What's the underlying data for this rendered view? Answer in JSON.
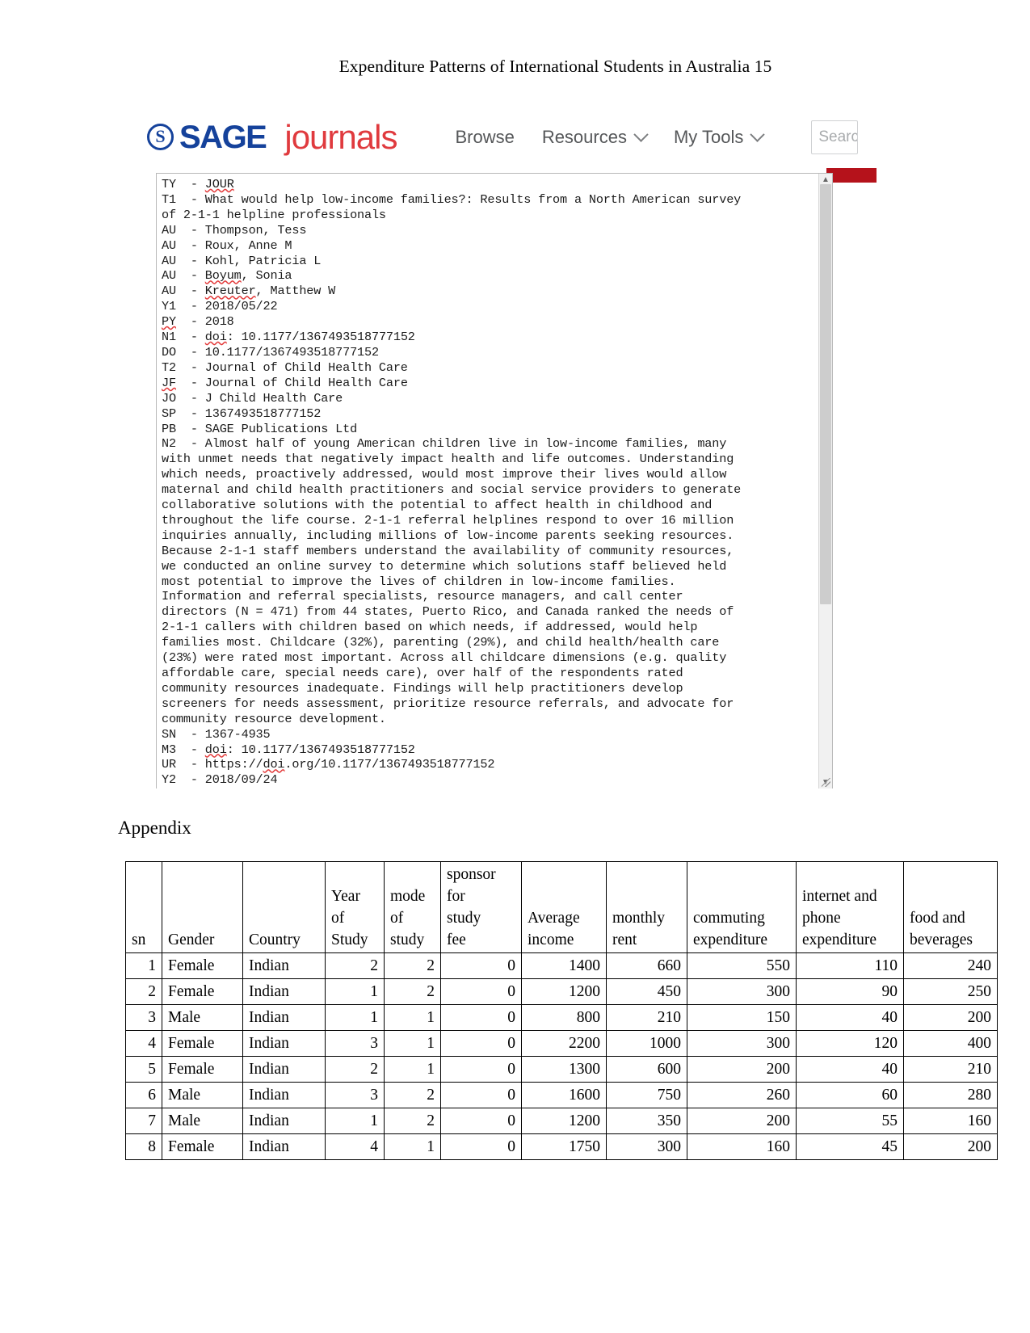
{
  "running_head": "Expenditure Patterns of International Students in Australia 15",
  "sage": {
    "logo_mark": "S",
    "logo_text": "SAGE",
    "logo_journals": "journals",
    "nav": [
      {
        "label": "Browse",
        "has_chevron": false
      },
      {
        "label": "Resources",
        "has_chevron": true
      },
      {
        "label": "My Tools",
        "has_chevron": true
      }
    ],
    "search_placeholder": "Searc",
    "accent_blue": "#15429b",
    "accent_red": "#e03a3e",
    "bar_red": "#b5121b"
  },
  "ris": {
    "lines": [
      "TY  - JOUR",
      "T1  - What would help low-income families?: Results from a North American survey",
      "of 2-1-1 helpline professionals",
      "AU  - Thompson, Tess",
      "AU  - Roux, Anne M",
      "AU  - Kohl, Patricia L",
      "AU  - Boyum, Sonia",
      "AU  - Kreuter, Matthew W",
      "Y1  - 2018/05/22",
      "PY  - 2018",
      "N1  - doi: 10.1177/1367493518777152",
      "DO  - 10.1177/1367493518777152",
      "T2  - Journal of Child Health Care",
      "JF  - Journal of Child Health Care",
      "JO  - J Child Health Care",
      "SP  - 1367493518777152",
      "PB  - SAGE Publications Ltd",
      "N2  - Almost half of young American children live in low-income families, many",
      "with unmet needs that negatively impact health and life outcomes. Understanding",
      "which needs, proactively addressed, would most improve their lives would allow",
      "maternal and child health practitioners and social service providers to generate",
      "collaborative solutions with the potential to affect health in childhood and",
      "throughout the life course. 2-1-1 referral helplines respond to over 16 million",
      "inquiries annually, including millions of low-income parents seeking resources.",
      "Because 2-1-1 staff members understand the availability of community resources,",
      "we conducted an online survey to determine which solutions staff believed held",
      "most potential to improve the lives of children in low-income families.",
      "Information and referral specialists, resource managers, and call center",
      "directors (N = 471) from 44 states, Puerto Rico, and Canada ranked the needs of",
      "2-1-1 callers with children based on which needs, if addressed, would help",
      "families most. Childcare (32%), parenting (29%), and child health/health care",
      "(23%) were rated most important. Across all childcare dimensions (e.g. quality",
      "affordable care, special needs care), over half of the respondents rated",
      "community resources inadequate. Findings will help practitioners develop",
      "screeners for needs assessment, prioritize resource referrals, and advocate for",
      "community resource development.",
      "SN  - 1367-4935",
      "M3  - doi: 10.1177/1367493518777152",
      "UR  - https://doi.org/10.1177/1367493518777152",
      "Y2  - 2018/09/24"
    ],
    "misspelled_words": [
      "JOUR",
      "Boyum",
      "Kreuter",
      "PY",
      "doi",
      "JF"
    ]
  },
  "appendix": {
    "title": "Appendix",
    "headers": [
      "sn",
      "Gender",
      "Country",
      "Year\nof\nStudy",
      "mode\nof\nstudy",
      "sponsor\nfor\nstudy\nfee",
      "Average\nincome",
      "monthly\nrent",
      "commuting\nexpenditure",
      "internet and\nphone\nexpenditure",
      "food and\nbeverages"
    ],
    "rows": [
      [
        "1",
        "Female",
        "Indian",
        "2",
        "2",
        "0",
        "1400",
        "660",
        "550",
        "110",
        "240"
      ],
      [
        "2",
        "Female",
        "Indian",
        "1",
        "2",
        "0",
        "1200",
        "450",
        "300",
        "90",
        "250"
      ],
      [
        "3",
        "Male",
        "Indian",
        "1",
        "1",
        "0",
        "800",
        "210",
        "150",
        "40",
        "200"
      ],
      [
        "4",
        "Female",
        "Indian",
        "3",
        "1",
        "0",
        "2200",
        "1000",
        "300",
        "120",
        "400"
      ],
      [
        "5",
        "Female",
        "Indian",
        "2",
        "1",
        "0",
        "1300",
        "600",
        "200",
        "40",
        "210"
      ],
      [
        "6",
        "Male",
        "Indian",
        "3",
        "2",
        "0",
        "1600",
        "750",
        "260",
        "60",
        "280"
      ],
      [
        "7",
        "Male",
        "Indian",
        "1",
        "2",
        "0",
        "1200",
        "350",
        "200",
        "55",
        "160"
      ],
      [
        "8",
        "Female",
        "Indian",
        "4",
        "1",
        "0",
        "1750",
        "300",
        "160",
        "45",
        "200"
      ]
    ]
  }
}
